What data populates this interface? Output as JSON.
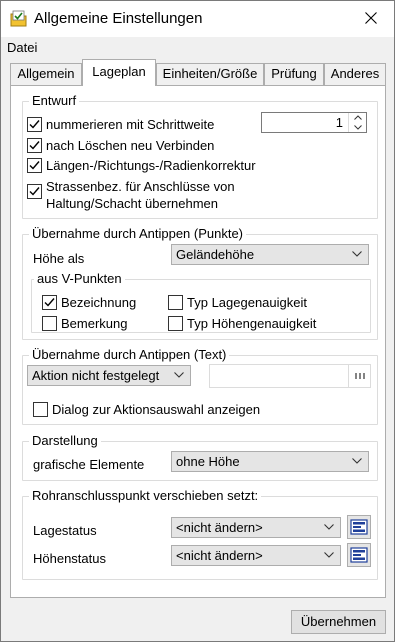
{
  "window": {
    "title": "Allgemeine Einstellungen",
    "close_glyph": "✕"
  },
  "menu": {
    "items": [
      "Datei"
    ]
  },
  "tabs": [
    {
      "label": "Allgemein",
      "active": false
    },
    {
      "label": "Lageplan",
      "active": true
    },
    {
      "label": "Einheiten/Größe",
      "active": false
    },
    {
      "label": "Prüfung",
      "active": false
    },
    {
      "label": "Anderes",
      "active": false
    }
  ],
  "entwurf": {
    "title": "Entwurf",
    "nummerieren_label": "nummerieren mit Schrittweite",
    "nummerieren_checked": true,
    "schrittweite_value": "1",
    "loeschen_label": "nach Löschen neu Verbinden",
    "loeschen_checked": true,
    "korrektur_label": "Längen-/Richtungs-/Radienkorrektur",
    "korrektur_checked": true,
    "strassen_label": "Strassenbez. für Anschlüsse von Haltung/Schacht übernehmen",
    "strassen_checked": true
  },
  "punkte": {
    "title": "Übernahme durch Antippen (Punkte)",
    "hoehe_label": "Höhe als",
    "hoehe_value": "Geländehöhe",
    "vpunkte_title": "aus V-Punkten",
    "bezeichnung_label": "Bezeichnung",
    "bezeichnung_checked": true,
    "bemerkung_label": "Bemerkung",
    "bemerkung_checked": false,
    "lagegenauigkeit_label": "Typ Lagegenauigkeit",
    "lagegenauigkeit_checked": false,
    "hoehengenauigkeit_label": "Typ Höhengenauigkeit",
    "hoehengenauigkeit_checked": false
  },
  "text": {
    "title": "Übernahme durch Antippen (Text)",
    "aktion_value": "Aktion nicht festgelegt",
    "aktion_text_value": "",
    "dialog_label": "Dialog zur Aktionsauswahl anzeigen",
    "dialog_checked": false
  },
  "darstellung": {
    "title": "Darstellung",
    "grafische_label": "grafische Elemente",
    "grafische_value": "ohne Höhe"
  },
  "rohranschluss": {
    "title": "Rohranschlusspunkt verschieben setzt:",
    "lagestatus_label": "Lagestatus",
    "lagestatus_value": "<nicht ändern>",
    "hoehenstatus_label": "Höhenstatus",
    "hoehenstatus_value": "<nicht ändern>"
  },
  "footer": {
    "apply_label": "Übernehmen"
  },
  "icons": {
    "app": "folder-check-icon",
    "close": "close-icon",
    "chevron": "chevron-down-icon",
    "check": "checkmark-icon",
    "status": "status-list-icon",
    "ellipsis": "ellipsis-icon"
  },
  "colors": {
    "window_bg": "#f0f0f0",
    "panel_bg": "#ffffff",
    "button_bg": "#e1e1e1",
    "accent_icon": "#1f3f9a"
  }
}
